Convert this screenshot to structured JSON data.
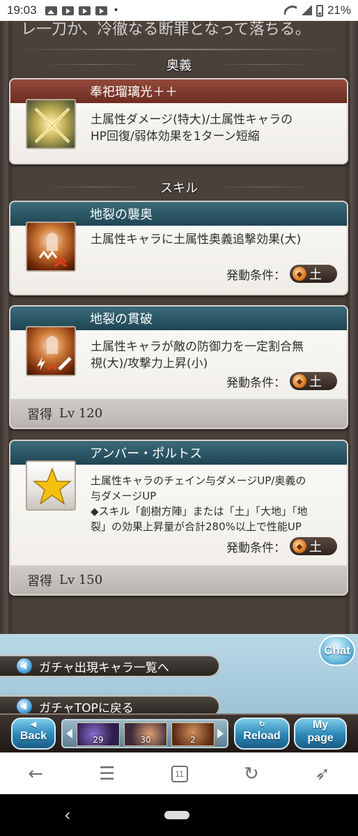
{
  "status_bar": {
    "time": "19:03",
    "battery": "21%"
  },
  "top_text": "レ一刀か、冷徹なる断罪となって落ちる。",
  "sections": {
    "ougi_title": "奥義",
    "skill_title": "スキル"
  },
  "ougi": {
    "name": "奉祀瑠璃光＋＋",
    "desc_line1": "土属性ダメージ(特大)/土属性キャラの",
    "desc_line2": "HP回復/弱体効果を1ターン短縮",
    "icon": "crossed-swords-icon"
  },
  "skills": [
    {
      "name": "地裂の襲奥",
      "desc_line1": "土属性キャラに土属性奥義追撃効果(大)",
      "condition_label": "発動条件：",
      "element": "土",
      "icon": "fist-attack-icon"
    },
    {
      "name": "地裂の貫破",
      "desc_line1": "土属性キャラが敵の防御力を一定割合無",
      "desc_line2": "視(大)/攻撃力上昇(小)",
      "condition_label": "発動条件：",
      "element": "土",
      "learn_label": "習得",
      "learn_lv": "Lv 120",
      "icon": "fist-sword-icon"
    },
    {
      "name": "アンバー・ポルトス",
      "desc_line1": "土属性キャラのチェイン与ダメージUP/奥義の",
      "desc_line2": "与ダメージUP",
      "desc_line3": "◆スキル「創樹方陣」または「土」「大地」「地",
      "desc_line4": "裂」の効果上昇量が合計280%以上で性能UP",
      "condition_label": "発動条件：",
      "element": "土",
      "learn_label": "習得",
      "learn_lv": "Lv 150",
      "icon": "star-icon"
    }
  ],
  "links": {
    "gacha_list": "ガチャ出現キャラ一覧へ",
    "gacha_top": "ガチャTOPに戻る"
  },
  "chat_label": "Chat",
  "footer": {
    "back_small": "◀",
    "back_label": "Back",
    "thumbs": [
      "29",
      "30",
      "2"
    ],
    "reload_label": "Reload",
    "mypage_small": "My",
    "mypage_label": "page"
  },
  "browser": {
    "tab_count": "11"
  }
}
